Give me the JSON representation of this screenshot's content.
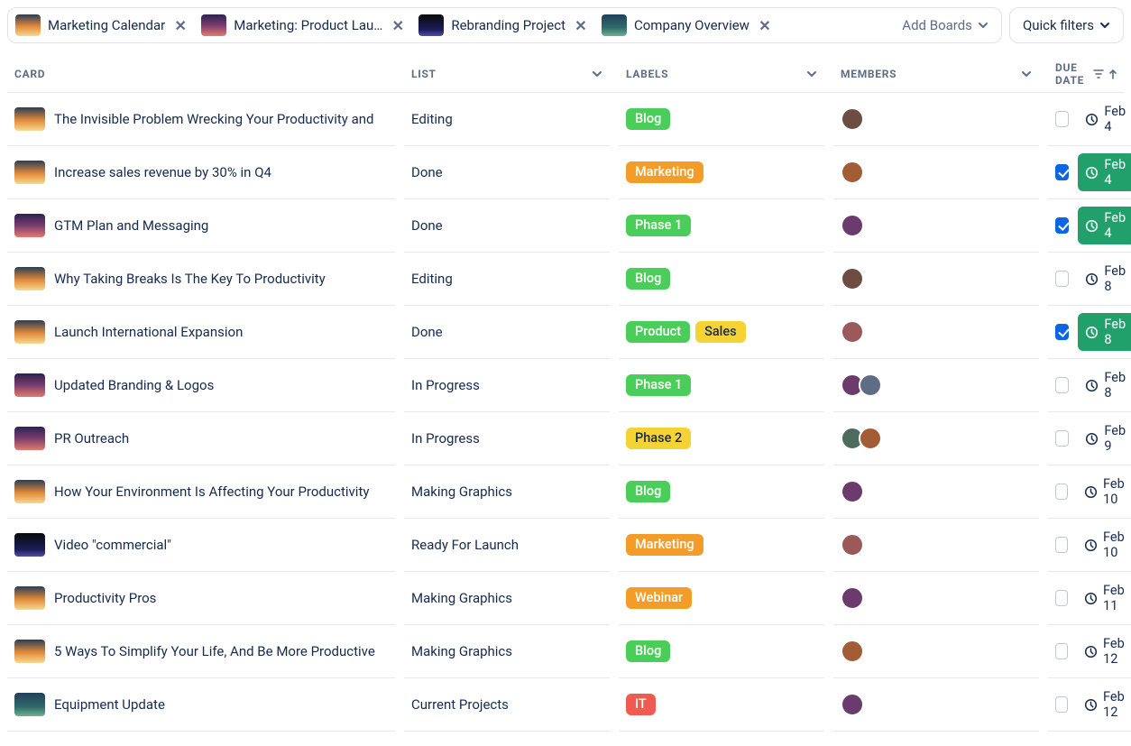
{
  "header": {
    "tabs": [
      {
        "label": "Marketing Calendar",
        "thumb": "g-sunset"
      },
      {
        "label": "Marketing: Product Lau…",
        "thumb": "g-dusk"
      },
      {
        "label": "Rebranding Project",
        "thumb": "g-launch"
      },
      {
        "label": "Company Overview",
        "thumb": "g-ocean"
      }
    ],
    "add_boards_label": "Add Boards",
    "quick_filters_label": "Quick filters"
  },
  "columns": {
    "card": "CARD",
    "list": "LIST",
    "labels": "LABELS",
    "members": "MEMBERS",
    "due": "DUE DATE"
  },
  "label_colors": {
    "Blog": "#4bce59",
    "Marketing": "#f39c2a",
    "Phase 1": "#4bce59",
    "Phase 2": "#f5d335",
    "Product": "#4bce59",
    "Sales": "#f5d335",
    "Webinar": "#f39c2a",
    "IT": "#ef5b50"
  },
  "rows": [
    {
      "thumb": "g-sunset",
      "title": "The Invisible Problem Wrecking Your Productivity and",
      "list": "Editing",
      "labels": [
        "Blog"
      ],
      "members": [
        "av1"
      ],
      "due": "Feb 4",
      "done": false
    },
    {
      "thumb": "g-sunset",
      "title": "Increase sales revenue by 30% in Q4",
      "list": "Done",
      "labels": [
        "Marketing"
      ],
      "members": [
        "av2"
      ],
      "due": "Feb 4",
      "done": true
    },
    {
      "thumb": "g-dusk",
      "title": "GTM Plan and Messaging",
      "list": "Done",
      "labels": [
        "Phase 1"
      ],
      "members": [
        "av3"
      ],
      "due": "Feb 4",
      "done": true
    },
    {
      "thumb": "g-sunset",
      "title": "Why Taking Breaks Is The Key To Productivity",
      "list": "Editing",
      "labels": [
        "Blog"
      ],
      "members": [
        "av1"
      ],
      "due": "Feb 8",
      "done": false
    },
    {
      "thumb": "g-sunset",
      "title": "Launch International Expansion",
      "list": "Done",
      "labels": [
        "Product",
        "Sales"
      ],
      "members": [
        "av4"
      ],
      "due": "Feb 8",
      "done": true
    },
    {
      "thumb": "g-dusk",
      "title": "Updated Branding & Logos",
      "list": "In Progress",
      "labels": [
        "Phase 1"
      ],
      "members": [
        "av3",
        "av6"
      ],
      "due": "Feb 8",
      "done": false
    },
    {
      "thumb": "g-dusk",
      "title": "PR Outreach",
      "list": "In Progress",
      "labels": [
        "Phase 2"
      ],
      "members": [
        "av5",
        "av2"
      ],
      "due": "Feb 9",
      "done": false
    },
    {
      "thumb": "g-sunset",
      "title": "How Your Environment Is Affecting Your Productivity",
      "list": "Making Graphics",
      "labels": [
        "Blog"
      ],
      "members": [
        "av3"
      ],
      "due": "Feb 10",
      "done": false
    },
    {
      "thumb": "g-launch",
      "title": "Video \"commercial\"",
      "list": "Ready For Launch",
      "labels": [
        "Marketing"
      ],
      "members": [
        "av4"
      ],
      "due": "Feb 10",
      "done": false
    },
    {
      "thumb": "g-sunset",
      "title": "Productivity Pros",
      "list": "Making Graphics",
      "labels": [
        "Webinar"
      ],
      "members": [
        "av3"
      ],
      "due": "Feb 11",
      "done": false
    },
    {
      "thumb": "g-sunset",
      "title": "5 Ways To Simplify Your Life, And Be More Productive",
      "list": "Making Graphics",
      "labels": [
        "Blog"
      ],
      "members": [
        "av2"
      ],
      "due": "Feb 12",
      "done": false
    },
    {
      "thumb": "g-ocean",
      "title": "Equipment Update",
      "list": "Current Projects",
      "labels": [
        "IT"
      ],
      "members": [
        "av3"
      ],
      "due": "Feb 12",
      "done": false
    }
  ]
}
